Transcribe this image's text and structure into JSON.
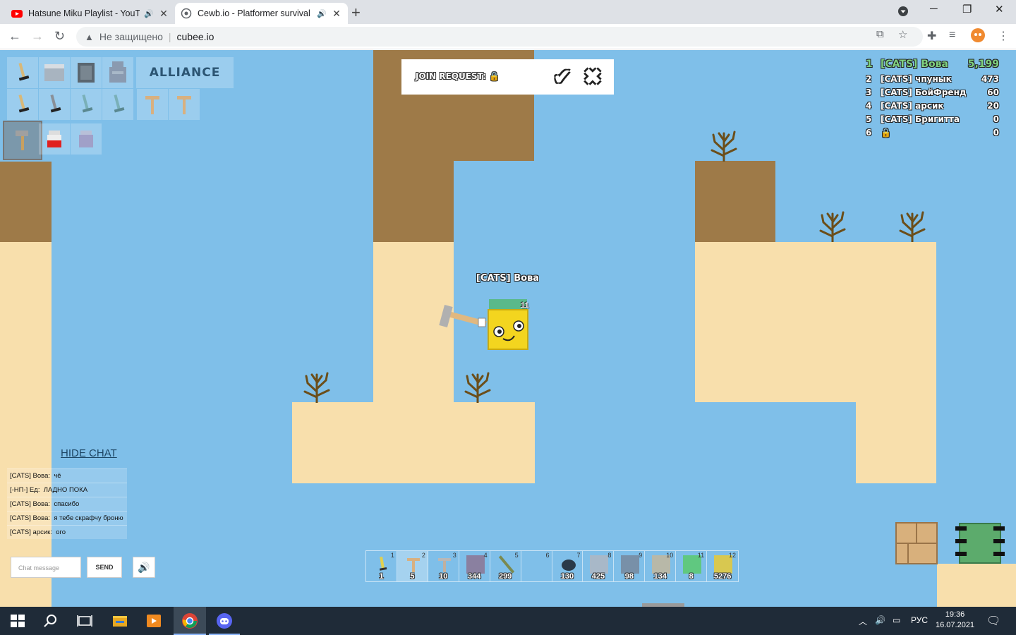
{
  "browser": {
    "tabs": [
      {
        "title": "Hatsune Miku Playlist - YouT",
        "active": false
      },
      {
        "title": "Cewb.io - Platformer survival",
        "active": true
      }
    ],
    "security_label": "Не защищено",
    "url": "cubee.io"
  },
  "game": {
    "alliance_label": "ALLIANCE",
    "join_request_label": "JOIN REQUEST:",
    "player_name": "[CATS] Вова",
    "player_level": "11",
    "leaderboard": [
      {
        "rank": "1",
        "name": "[CATS] Вова",
        "score": "5,199"
      },
      {
        "rank": "2",
        "name": "[CATS] чпунык",
        "score": "473"
      },
      {
        "rank": "3",
        "name": "[CATS] БойФренд",
        "score": "60"
      },
      {
        "rank": "4",
        "name": "[CATS] арсик",
        "score": "20"
      },
      {
        "rank": "5",
        "name": "[CATS] Бригитта",
        "score": "0"
      },
      {
        "rank": "6",
        "name": "",
        "score": "0"
      }
    ],
    "chat": {
      "hide_label": "HIDE CHAT",
      "messages": [
        {
          "author": "[CATS] Вова:",
          "text": "чё"
        },
        {
          "author": "[-НП-] Ед:",
          "text": "ЛАДНО ПОКА"
        },
        {
          "author": "[CATS] Вова:",
          "text": "спасибо"
        },
        {
          "author": "[CATS] Вова:",
          "text": "я тебе скрафчу броню"
        },
        {
          "author": "[CATS] арсик:",
          "text": "ого"
        }
      ],
      "input_placeholder": "Chat message",
      "send_label": "SEND"
    },
    "hotbar": [
      {
        "num": "1",
        "count": "1",
        "icon": "sword-icon",
        "color": "#e0d050"
      },
      {
        "num": "2",
        "count": "5",
        "icon": "pickaxe-icon",
        "color": "#d8b080"
      },
      {
        "num": "3",
        "count": "10",
        "icon": "pickaxe-icon",
        "color": "#b8b8b8"
      },
      {
        "num": "4",
        "count": "344",
        "icon": "stone-block-icon",
        "color": "#8a80a0"
      },
      {
        "num": "5",
        "count": "299",
        "icon": "stick-icon",
        "color": "#7a8a50"
      },
      {
        "num": "6",
        "count": "",
        "icon": "empty-slot",
        "color": ""
      },
      {
        "num": "7",
        "count": "130",
        "icon": "coal-icon",
        "color": "#2a3a4a"
      },
      {
        "num": "8",
        "count": "425",
        "icon": "iron-block-icon",
        "color": "#a8b8c8"
      },
      {
        "num": "9",
        "count": "98",
        "icon": "cobble-block-icon",
        "color": "#7890a8"
      },
      {
        "num": "10",
        "count": "134",
        "icon": "gravel-block-icon",
        "color": "#b8b8a8"
      },
      {
        "num": "11",
        "count": "8",
        "icon": "emerald-block-icon",
        "color": "#60c880"
      },
      {
        "num": "12",
        "count": "5276",
        "icon": "sand-block-icon",
        "color": "#d8c850"
      }
    ]
  },
  "taskbar": {
    "lang": "РУС",
    "time": "19:36",
    "date": "16.07.2021"
  }
}
